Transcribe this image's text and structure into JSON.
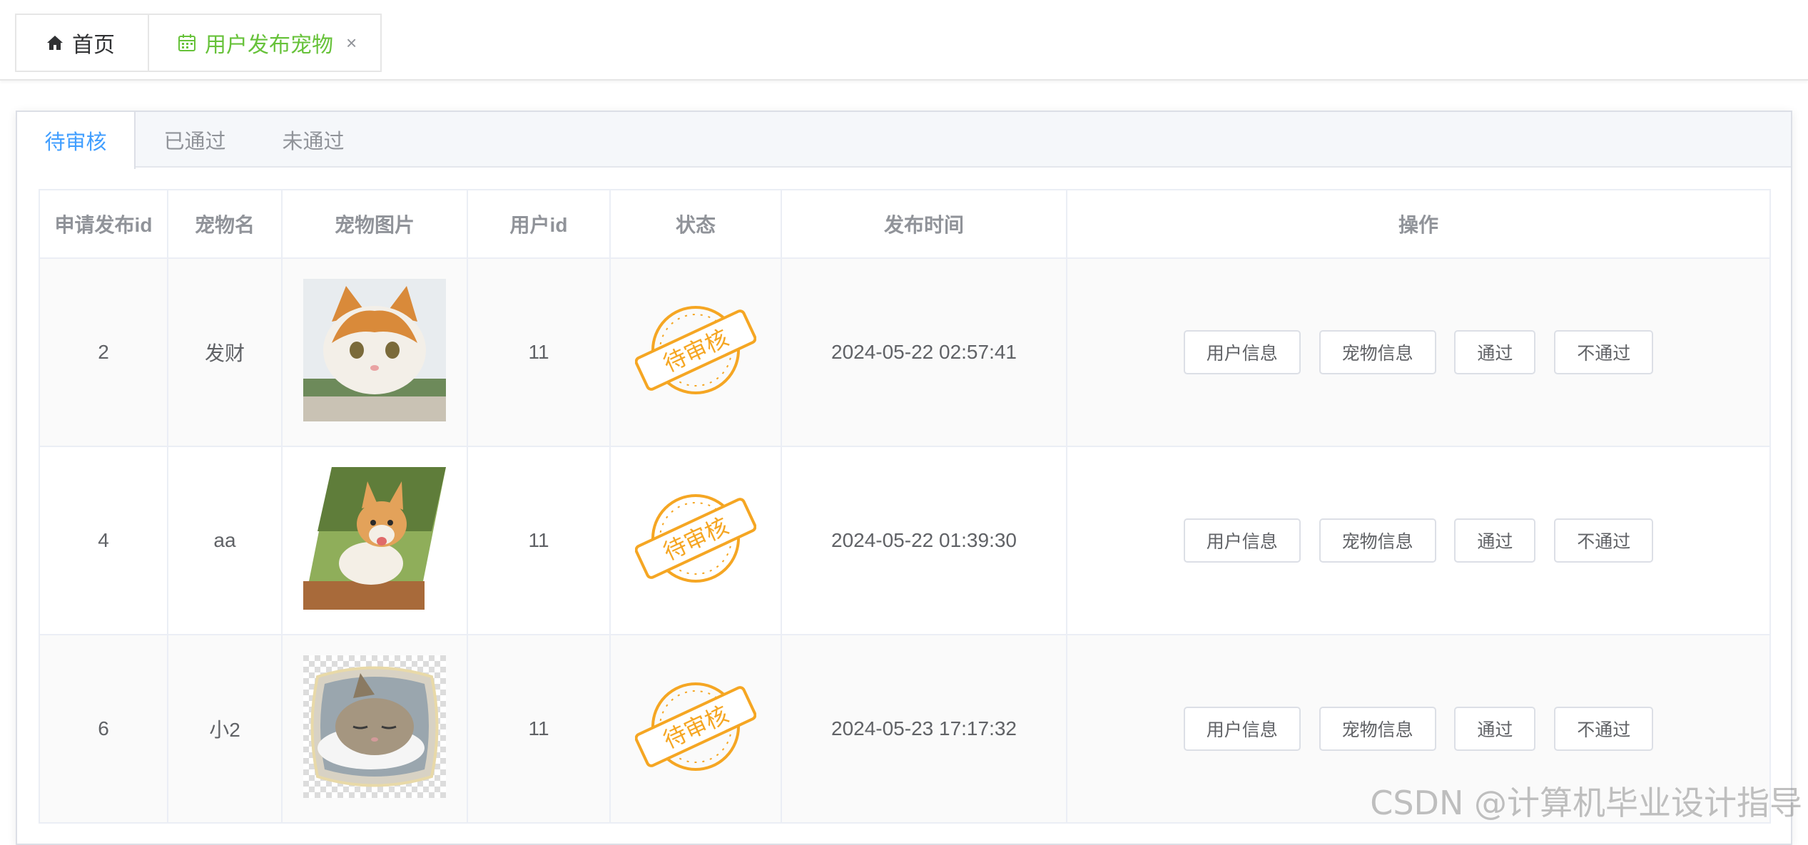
{
  "tagbar": {
    "home_label": "首页",
    "pet_label": "用户发布宠物",
    "close_glyph": "×",
    "home_icon": "home-icon",
    "pet_icon": "calendar-icon",
    "active_color": "#67c23a"
  },
  "tabs": {
    "items": [
      {
        "label": "待审核",
        "active": true
      },
      {
        "label": "已通过",
        "active": false
      },
      {
        "label": "未通过",
        "active": false
      }
    ],
    "active_color": "#409eff"
  },
  "table": {
    "headers": [
      "申请发布id",
      "宠物名",
      "宠物图片",
      "用户id",
      "状态",
      "发布时间",
      "操作"
    ],
    "rows": [
      {
        "id": "2",
        "name": "发财",
        "image": "orange-white-cat",
        "user_id": "11",
        "status": "待审核",
        "time": "2024-05-22 02:57:41"
      },
      {
        "id": "4",
        "name": "aa",
        "image": "corgi-puppy",
        "user_id": "11",
        "status": "待审核",
        "time": "2024-05-22 01:39:30"
      },
      {
        "id": "6",
        "name": "小2",
        "image": "sleeping-tabby-cat",
        "user_id": "11",
        "status": "待审核",
        "time": "2024-05-23 17:17:32"
      }
    ],
    "actions": {
      "user_info": "用户信息",
      "pet_info": "宠物信息",
      "approve": "通过",
      "reject": "不通过"
    },
    "stamp_color": "#f5a623"
  },
  "watermark": "CSDN @计算机毕业设计指导"
}
